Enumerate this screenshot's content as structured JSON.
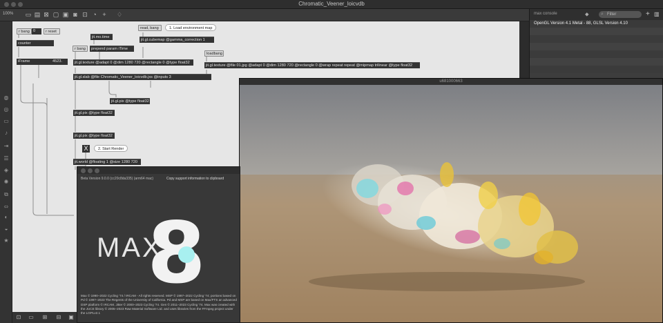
{
  "window": {
    "title": "Chromatic_Veener_loicvdb"
  },
  "toolbar": {
    "zoom": "100%"
  },
  "patch": {
    "objects": {
      "rbang1": "r bang",
      "num0": "0",
      "rreset": "r reset",
      "counter": "counter",
      "mo_time": "jit.mo.time",
      "prepend": "prepend param iTime",
      "rbang2": "r bang",
      "readbang": "read, bang",
      "cubemap": "jit.gl.cubemap @gamma_correction 1",
      "iframe": "iFrame",
      "iframe_val": "4523.",
      "texture1": "jit.gl.texture @adapt 0 @dim 1280 720 @rectangle 0 @type float32",
      "loadbang": "loadbang",
      "texture2": "jit.gl.texture @file 01.jpg @adapt 0 @dim 1280 720 @rectangle 0 @wrap repeat repeat @mipmap trilinear @type float32",
      "slab": "jit.gl.slab @file Chromatic_Veener_loicvdb.jxs @inputs 3",
      "pix1": "jit.gl.pix @type float32",
      "pix2": "jit.gl.pix @type float32",
      "pix3": "jit.gl.pix @type float32",
      "toggle": "X",
      "world": "jit.world @floating 1 @size 1280 720"
    },
    "comments": {
      "load_env": "1. Load environment map",
      "start_render": "2. Start Render"
    }
  },
  "console": {
    "title": "max console",
    "filter_placeholder": "Filter",
    "messages": [
      "OpenGL Version 4.1 Metal - 88, GLSL Version 4.10"
    ]
  },
  "render_window": {
    "title": "u681000663"
  },
  "about": {
    "version": "Beta Version 9.0.0 (cc20c8da335) (arm64 mac)",
    "copy_link": "Copy support information to clipboard",
    "logo_word": "MAX",
    "logo_number": "8",
    "legal": "Max © 1990–2022 Cycling '74 / IRCAM - All rights reserved. MSP © 1997–2022 Cycling '74; portions based on Pd © 1997–2023 The Regents of the University of California. Pd and MSP are based on Max/FTS an advanced DSP platform © IRCAM. Jitter © 2000–2023 Cycling '74. Gen © 2011–2023 Cycling '74. Max was created with the JUCE library © 2005–2023 Raw Material Software Ltd. and uses libraries from the FFmpeg project under the LGPLv2.1"
  },
  "colors": {
    "accent_teal": "#a8f0f0",
    "patch_bg": "#e6e6e6",
    "object_bg": "#333333"
  }
}
